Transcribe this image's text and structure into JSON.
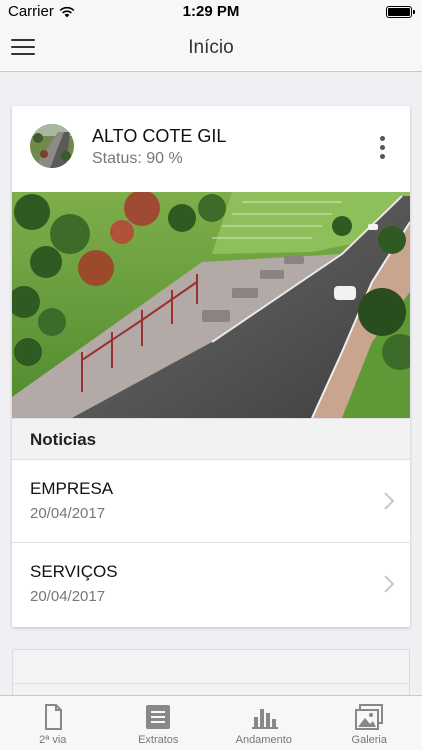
{
  "status_bar": {
    "carrier": "Carrier",
    "time": "1:29 PM",
    "battery_level": 1.0
  },
  "nav": {
    "title": "Início",
    "menu_icon": "hamburger-menu-icon"
  },
  "project": {
    "name": "ALTO COTE GIL",
    "status": "Status: 90 %",
    "more_icon": "more-vertical-icon"
  },
  "news": {
    "section_title": "Noticias",
    "items": [
      {
        "title": "EMPRESA",
        "date": "20/04/2017"
      },
      {
        "title": "SERVIÇOS",
        "date": "20/04/2017"
      }
    ]
  },
  "tabs": [
    {
      "label": "2ª via",
      "icon": "document-icon"
    },
    {
      "label": "Extratos",
      "icon": "statement-icon"
    },
    {
      "label": "Andamento",
      "icon": "bar-chart-icon"
    },
    {
      "label": "Galeria",
      "icon": "gallery-icon"
    }
  ],
  "colors": {
    "background": "#efeff4",
    "bar": "#f7f7f7",
    "icon_gray": "#888888"
  }
}
